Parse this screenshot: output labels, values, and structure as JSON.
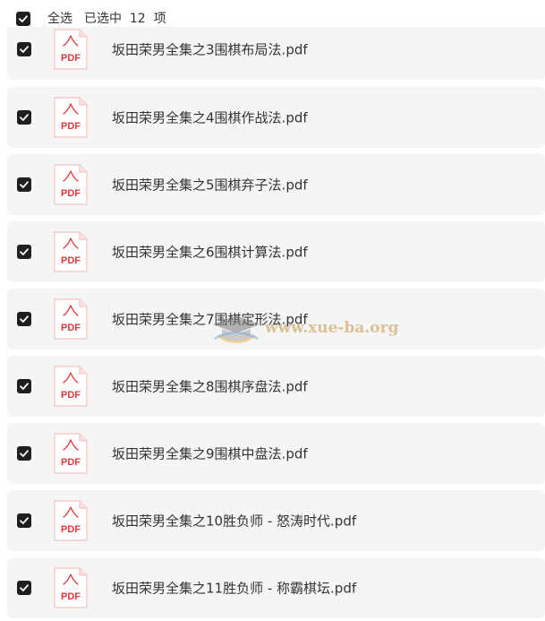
{
  "header": {
    "select_all_label": "全选",
    "selected_status": "已选中  12  项",
    "checked": true
  },
  "icons": {
    "checkbox": "checkmark-icon",
    "file": "pdf-file-icon",
    "file_badge": "PDF"
  },
  "colors": {
    "checkbox_fill": "#1f1f1f",
    "row_background": "#f5f5f5",
    "pdf_red": "#e0383b"
  },
  "watermark": {
    "text": "www.xue-ba.org"
  },
  "files": [
    {
      "name": "坂田荣男全集之3围棋布局法.pdf",
      "checked": true
    },
    {
      "name": "坂田荣男全集之4围棋作战法.pdf",
      "checked": true
    },
    {
      "name": "坂田荣男全集之5围棋弃子法.pdf",
      "checked": true
    },
    {
      "name": "坂田荣男全集之6围棋计算法.pdf",
      "checked": true
    },
    {
      "name": "坂田荣男全集之7围棋定形法.pdf",
      "checked": true
    },
    {
      "name": "坂田荣男全集之8围棋序盘法.pdf",
      "checked": true
    },
    {
      "name": "坂田荣男全集之9围棋中盘法.pdf",
      "checked": true
    },
    {
      "name": "坂田荣男全集之10胜负师 - 怒涛时代.pdf",
      "checked": true
    },
    {
      "name": "坂田荣男全集之11胜负师 - 称霸棋坛.pdf",
      "checked": true
    }
  ]
}
